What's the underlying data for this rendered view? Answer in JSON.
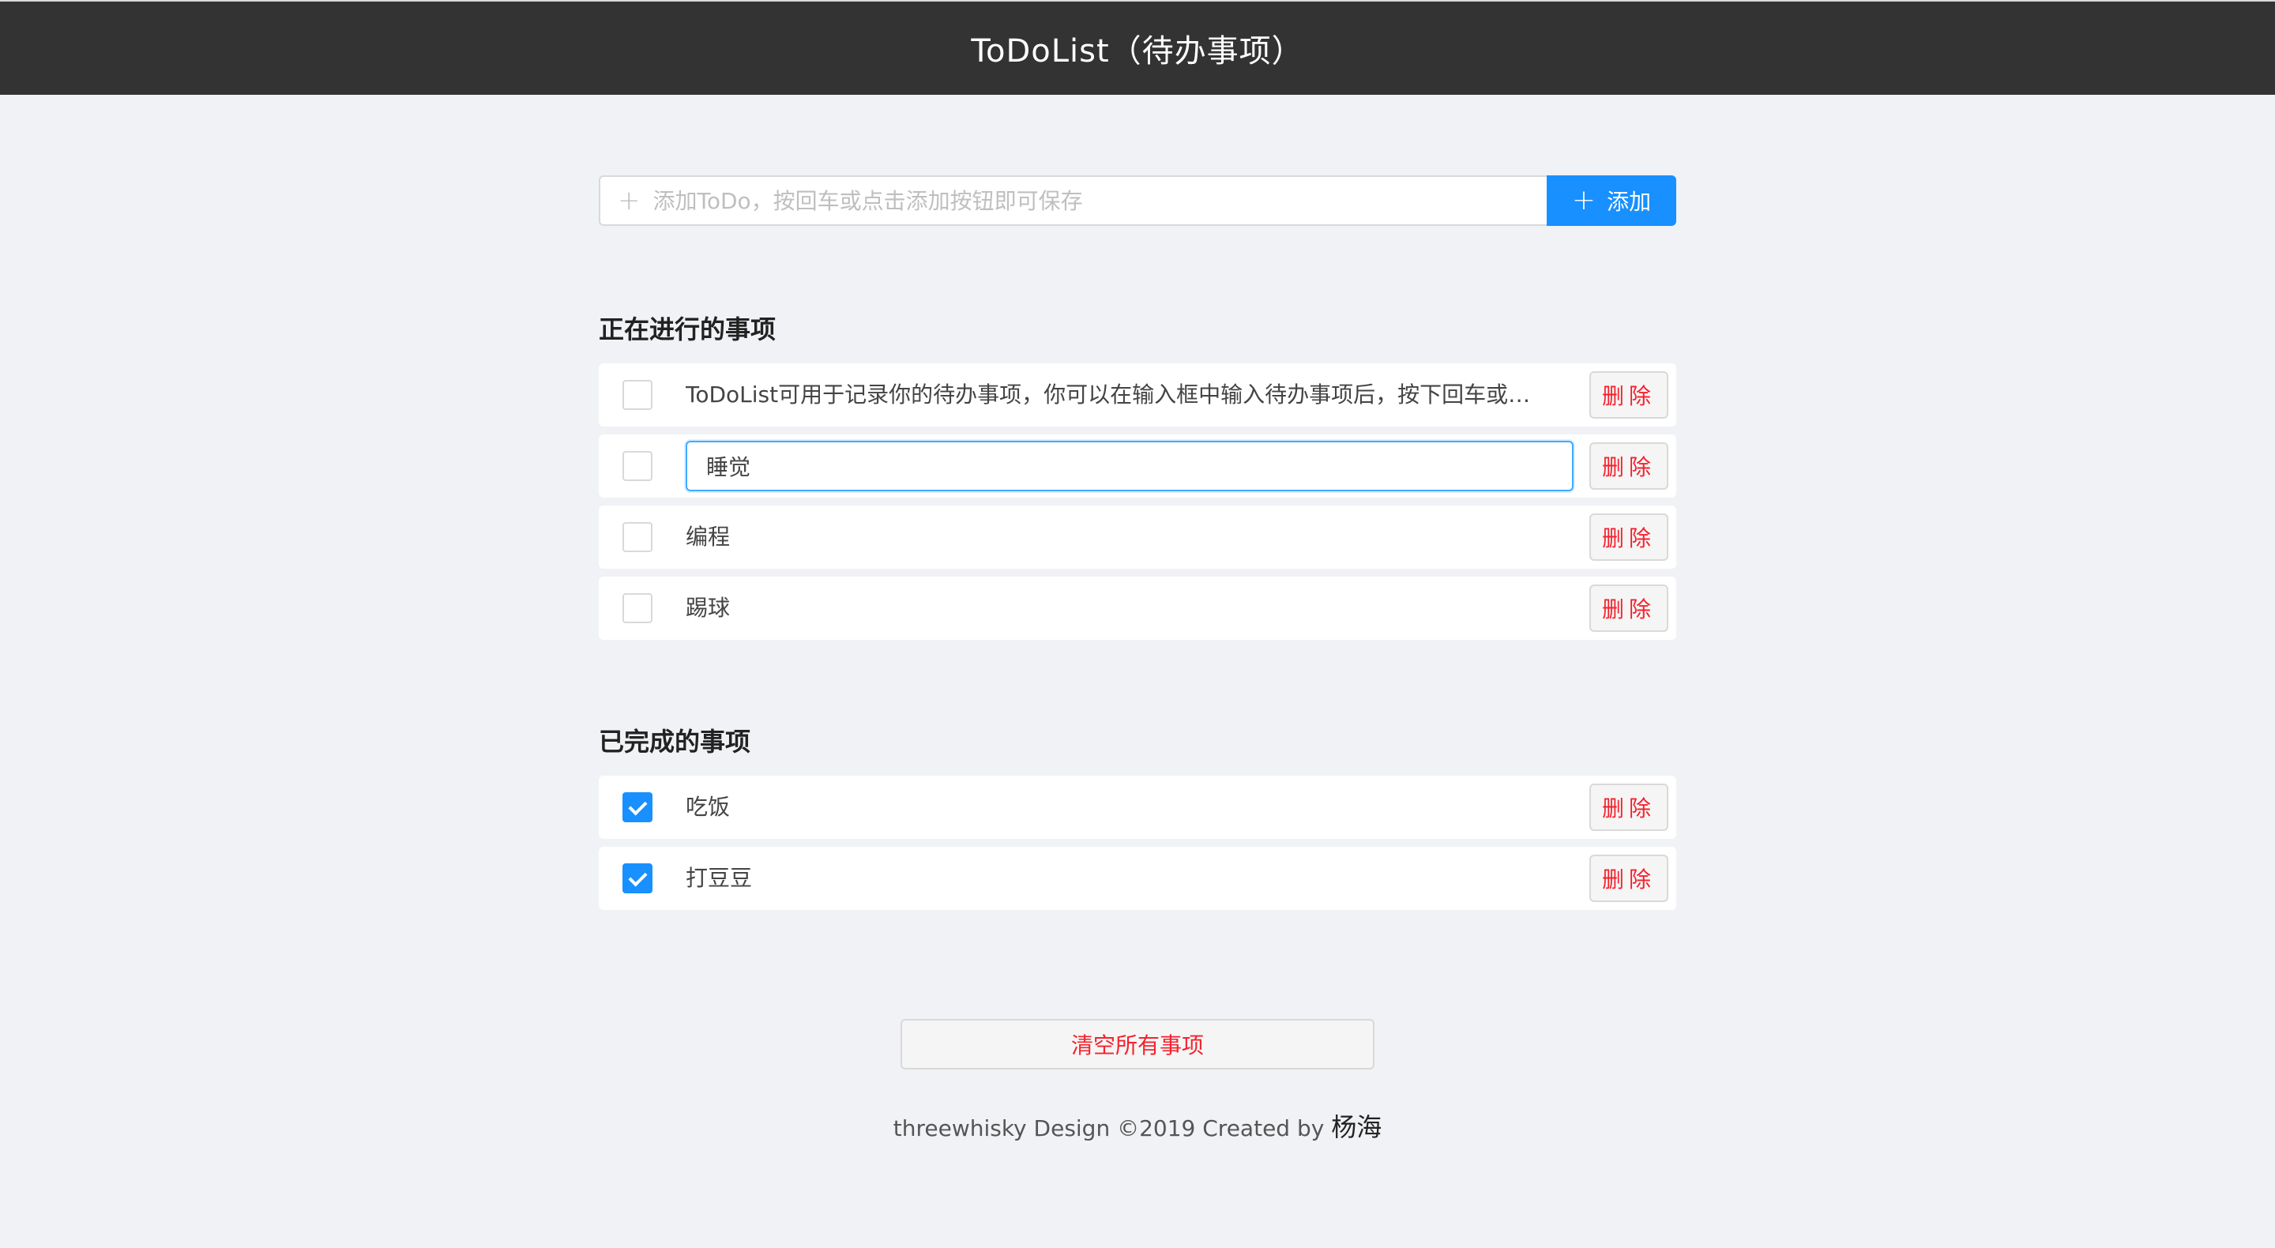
{
  "header": {
    "title": "ToDoList（待办事项）"
  },
  "add_bar": {
    "placeholder": "添加ToDo，按回车或点击添加按钮即可保存",
    "value": "",
    "button_label": "添加"
  },
  "in_progress": {
    "title": "正在进行的事项",
    "items": [
      {
        "text": "ToDoList可用于记录你的待办事项，你可以在输入框中输入待办事项后，按下回车或点击...",
        "checked": false,
        "editing": false
      },
      {
        "text": "睡觉",
        "checked": false,
        "editing": true
      },
      {
        "text": "编程",
        "checked": false,
        "editing": false
      },
      {
        "text": "踢球",
        "checked": false,
        "editing": false
      }
    ]
  },
  "completed": {
    "title": "已完成的事项",
    "items": [
      {
        "text": "吃饭",
        "checked": true
      },
      {
        "text": "打豆豆",
        "checked": true
      }
    ]
  },
  "delete_label": "删除",
  "clear_button_label": "清空所有事项",
  "footer": {
    "text": "threewhisky Design ©2019 Created by ",
    "author": "杨海"
  },
  "colors": {
    "header_bg": "#333333",
    "accent": "#1890ff",
    "danger": "#f5222d",
    "page_bg": "#f0f2f5"
  }
}
